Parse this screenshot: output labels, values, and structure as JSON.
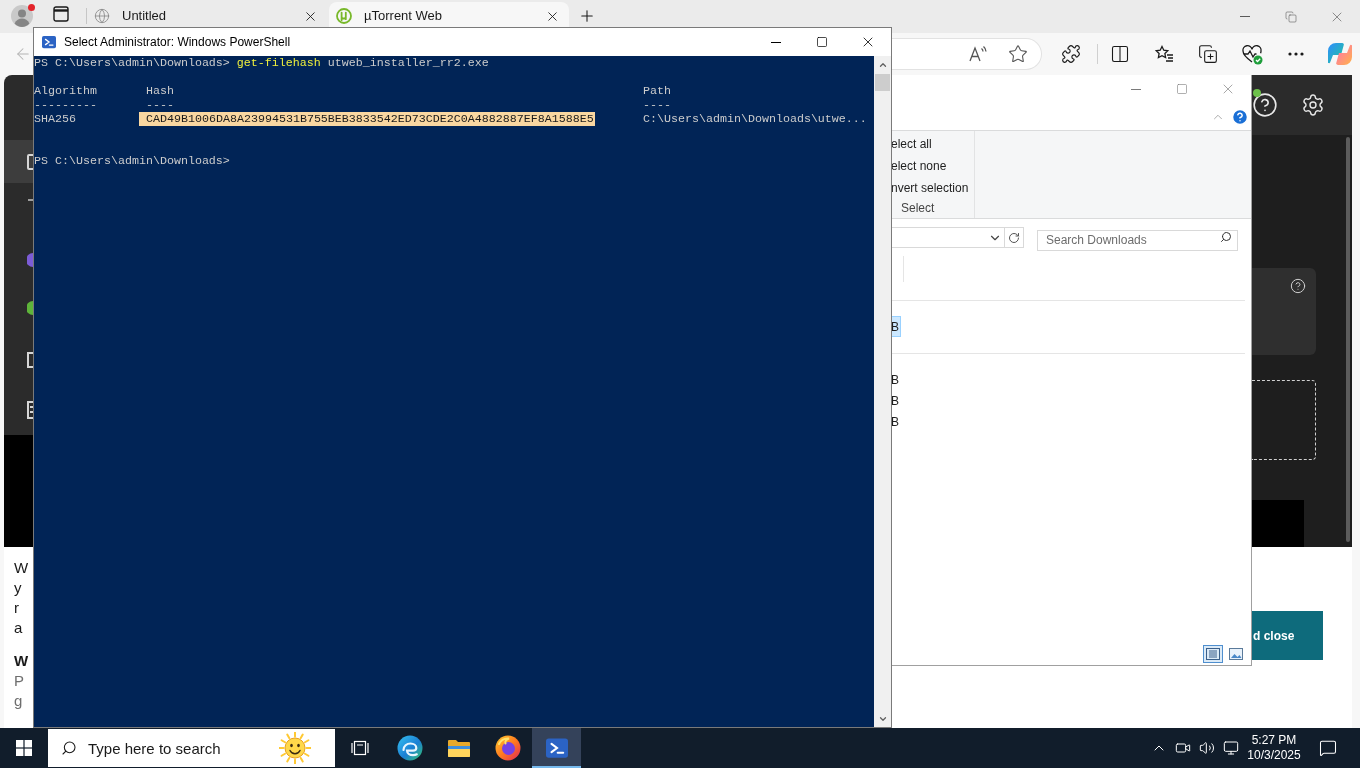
{
  "browser": {
    "profile": {
      "notification": true
    },
    "tabs": [
      {
        "kind": "globe",
        "title": "Untitled",
        "selected": false
      },
      {
        "kind": "utorrent",
        "title": "µTorrent Web",
        "selected": true
      }
    ]
  },
  "page": {
    "sidebar": [
      {
        "kind": "rounded_square",
        "color": "#d6d6d6",
        "selected": true
      },
      {
        "kind": "dash",
        "color": "#9e9e9e",
        "selected": false
      },
      {
        "kind": "filled_circle",
        "color": "#7c5cd6",
        "selected": false
      },
      {
        "kind": "filled_circle",
        "color": "#5eb43a",
        "selected": false
      },
      {
        "kind": "square",
        "color": "#d6d6d6",
        "selected": false
      },
      {
        "kind": "document",
        "color": "#d6d6d6",
        "selected": false
      }
    ],
    "help": {
      "notification": true
    },
    "text_fragments": [
      {
        "kind": "body",
        "text": "W"
      },
      {
        "kind": "body",
        "text": "y"
      },
      {
        "kind": "body",
        "text": "r"
      },
      {
        "kind": "body",
        "text": "a"
      },
      {
        "kind": "heading",
        "text": "W"
      },
      {
        "kind": "muted",
        "text": "P"
      },
      {
        "kind": "muted",
        "text": "g"
      }
    ],
    "action_button": {
      "label": "d close"
    }
  },
  "powershell": {
    "title": "Select Administrator: Windows PowerShell",
    "prompt": "PS C:\\Users\\admin\\Downloads>",
    "command": "get-filehash",
    "argument": "utweb_installer_rr2.exe",
    "table": {
      "columns": [
        {
          "header": "Algorithm",
          "rule": "---------"
        },
        {
          "header": "Hash",
          "rule": "----"
        },
        {
          "header": "Path",
          "rule": "----"
        }
      ],
      "rows": [
        {
          "algorithm": "SHA256",
          "hash": "CAD49B1006DA8A23994531B755BEB3833542ED73CDE2C0A4882887EF8A1588E5",
          "path": "C:\\Users\\admin\\Downloads\\utwe...",
          "selected": true
        }
      ]
    },
    "final_prompt": "PS C:\\Users\\admin\\Downloads>"
  },
  "explorer": {
    "ribbon": {
      "commands": [
        "elect all",
        "elect none",
        "nvert selection"
      ],
      "group": "Select"
    },
    "search": {
      "placeholder": "Search Downloads"
    },
    "groups": [
      {
        "files": [
          {
            "size": "B",
            "selected": true
          }
        ]
      },
      {
        "files": [
          {
            "size": "B",
            "selected": false
          },
          {
            "size": "B",
            "selected": false
          },
          {
            "size": "B",
            "selected": false
          }
        ]
      }
    ],
    "views": [
      {
        "kind": "details",
        "selected": true
      },
      {
        "kind": "large_icons",
        "selected": false
      }
    ]
  },
  "taskbar": {
    "search": {
      "placeholder": "Type here to search"
    },
    "apps": [
      {
        "kind": "task_view",
        "selected": false
      },
      {
        "kind": "edge",
        "selected": false
      },
      {
        "kind": "file_explorer",
        "selected": false
      },
      {
        "kind": "firefox",
        "selected": false
      },
      {
        "kind": "powershell",
        "selected": true
      }
    ],
    "clock": {
      "time": "5:27 PM",
      "date": "10/3/2025"
    }
  }
}
